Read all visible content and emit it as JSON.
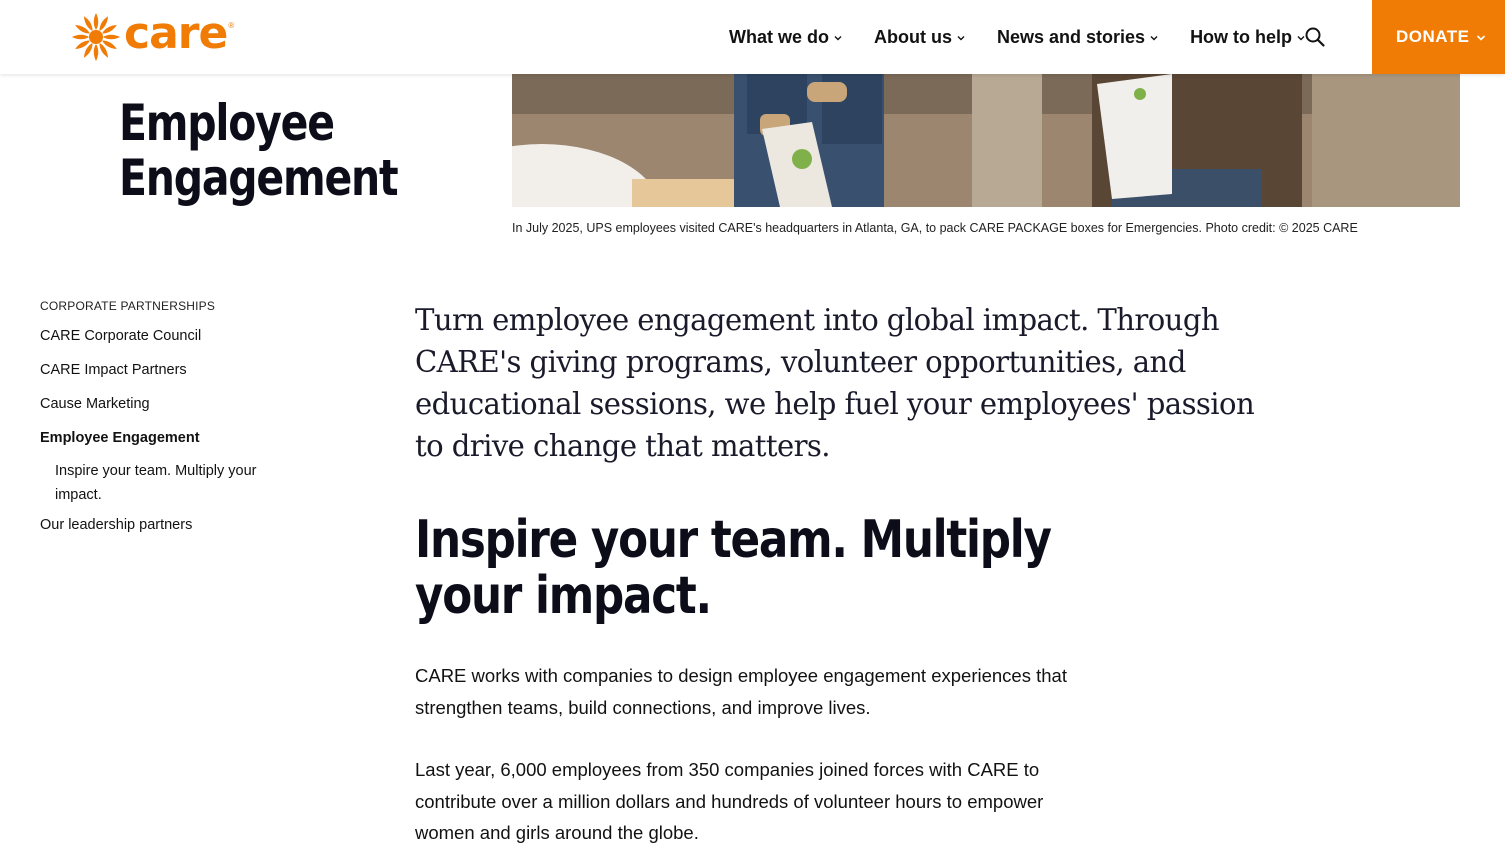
{
  "header": {
    "logo_text": "care",
    "logo_reg": "®",
    "nav": [
      {
        "label": "What we do"
      },
      {
        "label": "About us"
      },
      {
        "label": "News and stories"
      },
      {
        "label": "How to help"
      }
    ],
    "donate_label": "DONATE",
    "brand_color": "#f07b05"
  },
  "hero": {
    "title": "Employee Engagement",
    "caption": "In July 2025, UPS employees visited CARE's headquarters in Atlanta, GA, to pack CARE PACKAGE boxes for Emergencies. Photo credit: © 2025 CARE"
  },
  "sidebar": {
    "heading": "CORPORATE PARTNERSHIPS",
    "items": [
      {
        "label": "CARE Corporate Council"
      },
      {
        "label": "CARE Impact Partners"
      },
      {
        "label": "Cause Marketing"
      },
      {
        "label": "Employee Engagement",
        "active": true
      },
      {
        "label": "Inspire your team. Multiply your impact.",
        "sub": true
      },
      {
        "label": "Our leadership partners"
      }
    ]
  },
  "main": {
    "lead": "Turn employee engagement into global impact. Through CARE's giving programs, volunteer opportunities, and educational sessions, we help fuel your employees' passion to drive change that matters.",
    "section_heading": "Inspire your team. Multiply your impact.",
    "paragraphs": [
      "CARE works with companies to design employee engagement experiences that strengthen teams, build connections, and improve lives.",
      "Last year, 6,000 employees from 350 companies joined forces with CARE to contribute over a million dollars and hundreds of volunteer hours to empower women and girls around the globe."
    ]
  },
  "icons": {
    "search": "search-icon",
    "chevron": "chevron-down-icon",
    "logo": "care-logo-mark"
  }
}
